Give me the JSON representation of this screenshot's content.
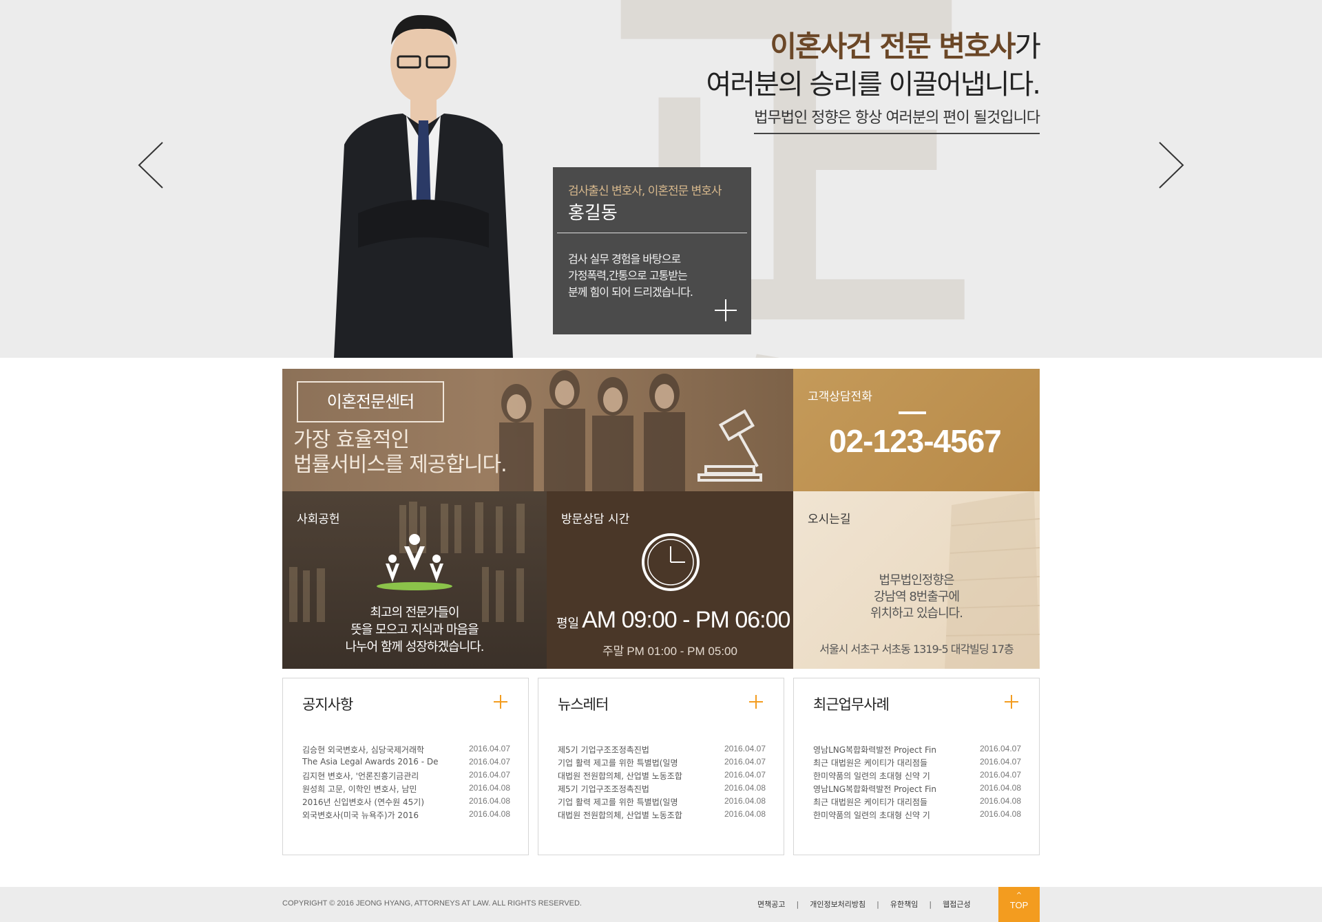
{
  "hero": {
    "bg_char": "正向",
    "headline_highlight": "이혼사건 전문 변호사",
    "headline_suffix": "가",
    "headline_line2": "여러분의 승리를 이끌어냅니다.",
    "tagline": "법무법인 정향은 항상 여러분의 편이 될것입니다",
    "profile": {
      "subtitle": "검사출신 변호사, 이혼전문 변호사",
      "name": "홍길동",
      "desc_lines": [
        "검사 실무 경험을 바탕으로",
        "가정폭력,간통으로 고통받는",
        "분께 힘이 되어 드리겠습니다."
      ]
    }
  },
  "tiles": {
    "center": {
      "box": "이혼전문센터",
      "slogan_line1": "가장 효율적인",
      "slogan_line2": "법률서비스를 제공합니다."
    },
    "phone": {
      "label": "고객상담전화",
      "number": "02-123-4567"
    },
    "social": {
      "label": "사회공헌",
      "lines": [
        "최고의 전문가들이",
        "뜻을 모으고 지식과 마음을",
        "나누어 함께 성장하겠습니다."
      ]
    },
    "hours": {
      "label": "방문상담 시간",
      "weekday_label": "평일",
      "weekday_time": "AM 09:00 - PM 06:00",
      "weekend_label": "주말",
      "weekend_time": "PM 01:00 - PM 05:00"
    },
    "map": {
      "label": "오시는길",
      "lines": [
        "법무법인정향은",
        "강남역 8번출구에",
        "위치하고 있습니다."
      ],
      "address": "서울시 서초구 서초동 1319-5 대각빌딩 17층"
    }
  },
  "boards": [
    {
      "title": "공지사항",
      "items": [
        {
          "title": "김승현 외국변호사, 심당국제거래학",
          "date": "2016.04.07"
        },
        {
          "title": "The Asia Legal Awards 2016 - De",
          "date": "2016.04.07"
        },
        {
          "title": "김지현 변호사, '언론진흥기금관리",
          "date": "2016.04.07"
        },
        {
          "title": "원성희 고문, 이학인 변호사, 남민",
          "date": "2016.04.08"
        },
        {
          "title": "2016년 신입변호사 (연수원 45기)",
          "date": "2016.04.08"
        },
        {
          "title": "외국변호사(미국 뉴욕주)가 2016",
          "date": "2016.04.08"
        }
      ]
    },
    {
      "title": "뉴스레터",
      "items": [
        {
          "title": "제5기 기업구조조정촉진법",
          "date": "2016.04.07"
        },
        {
          "title": "기업 활력 제고를 위한 특별법(일명",
          "date": "2016.04.07"
        },
        {
          "title": "대법원 전원합의체, 산업별 노동조합",
          "date": "2016.04.07"
        },
        {
          "title": "제5기 기업구조조정촉진법",
          "date": "2016.04.08"
        },
        {
          "title": "기업 활력 제고를 위한 특별법(일명",
          "date": "2016.04.08"
        },
        {
          "title": "대법원 전원합의체, 산업별 노동조합",
          "date": "2016.04.08"
        }
      ]
    },
    {
      "title": "최근업무사례",
      "items": [
        {
          "title": "영남LNG복합화력발전 Project Fin",
          "date": "2016.04.07"
        },
        {
          "title": "최근 대법원은 케이티가 대리점들",
          "date": "2016.04.07"
        },
        {
          "title": "한미약품의 일련의 초대형 신약 기",
          "date": "2016.04.07"
        },
        {
          "title": "영남LNG복합화력발전 Project Fin",
          "date": "2016.04.08"
        },
        {
          "title": "최근 대법원은 케이티가 대리점들",
          "date": "2016.04.08"
        },
        {
          "title": "한미약품의 일련의 초대형 신약 기",
          "date": "2016.04.08"
        }
      ]
    }
  ],
  "footer": {
    "copyright": "COPYRIGHT © 2016 JEONG HYANG, ATTORNEYS AT LAW. ALL RIGHTS RESERVED.",
    "links": [
      "면책공고",
      "개인정보처리방침",
      "유한책임",
      "웹접근성"
    ],
    "separator": "|",
    "top_label": "TOP",
    "top_chevron": "^"
  },
  "colors": {
    "accent_brown": "#6b4727",
    "profile_bg": "#4b4b4b",
    "hours_bg": "#4a3728",
    "phone_bg": "#c49a5a",
    "top_button": "#f39c1f"
  }
}
